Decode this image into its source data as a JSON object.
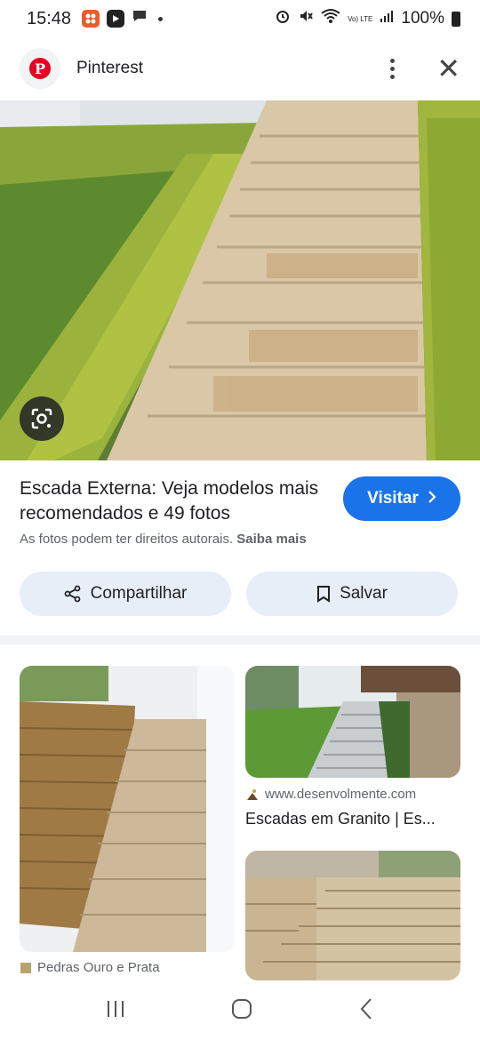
{
  "status_bar": {
    "time": "15:48",
    "battery": "100%",
    "volte": "Vo) LTE"
  },
  "header": {
    "title": "Pinterest"
  },
  "result": {
    "title": "Escada Externa: Veja modelos mais recomendados e 49 fotos",
    "visit_label": "Visitar",
    "copyright_text": "As fotos podem ter direitos autorais.",
    "learn_more": "Saiba mais",
    "share_label": "Compartilhar",
    "save_label": "Salvar"
  },
  "related": [
    {
      "source": "Pedras Ouro e Prata",
      "title": ""
    },
    {
      "source": "www.desenvolmente.com",
      "title": "Escadas em Granito | Es..."
    }
  ],
  "colors": {
    "accent": "#1a73e8",
    "chip_bg": "#e8eef8",
    "pinterest_red": "#e60023"
  }
}
